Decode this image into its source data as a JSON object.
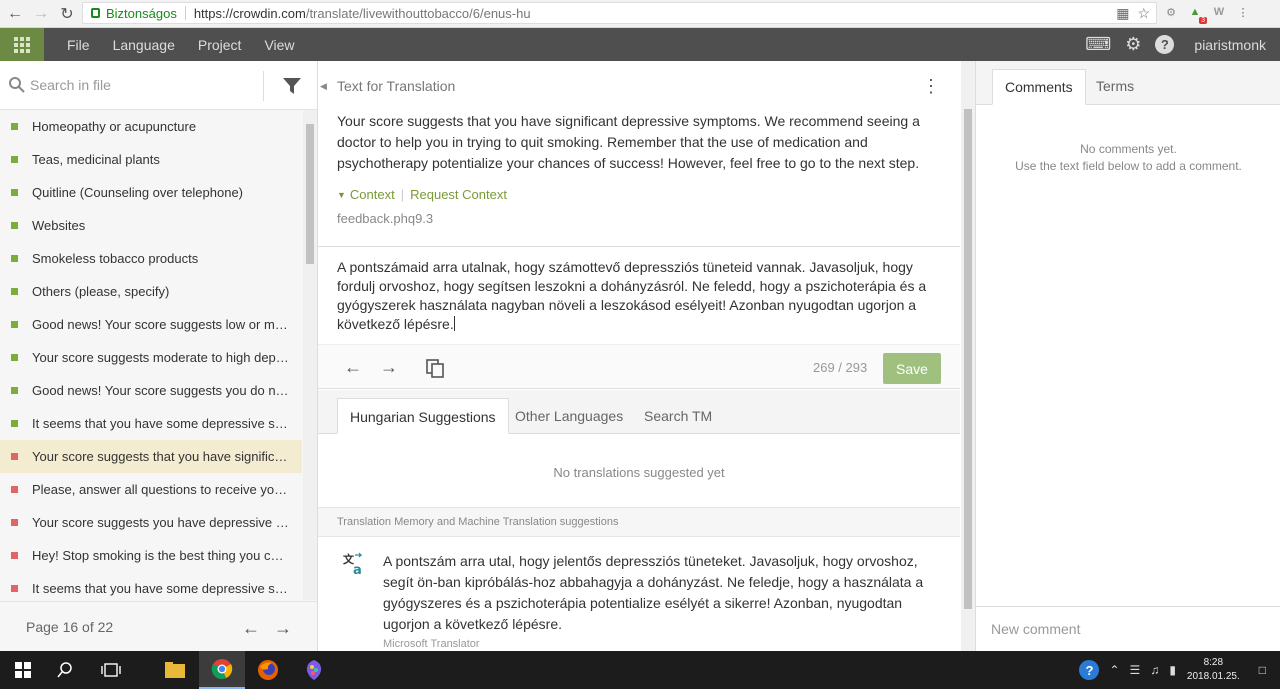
{
  "browser": {
    "secure_label": "Biztonságos",
    "url_host": "https://crowdin.com",
    "url_path": "/translate/livewithouttobacco/6/enus-hu",
    "extension_badge": "3"
  },
  "appbar": {
    "menu": [
      "File",
      "Language",
      "Project",
      "View"
    ],
    "username": "piaristmonk"
  },
  "sidebar": {
    "search_placeholder": "Search in file",
    "items": [
      {
        "label": "Homeopathy or acupuncture",
        "status_color": "#7cad3a",
        "active": false
      },
      {
        "label": "Teas, medicinal plants",
        "status_color": "#7cad3a",
        "active": false
      },
      {
        "label": "Quitline (Counseling over telephone)",
        "status_color": "#7cad3a",
        "active": false
      },
      {
        "label": "Websites",
        "status_color": "#7cad3a",
        "active": false
      },
      {
        "label": "Smokeless tobacco products",
        "status_color": "#7cad3a",
        "active": false
      },
      {
        "label": "Others (please, specify)",
        "status_color": "#7cad3a",
        "active": false
      },
      {
        "label": "Good news! Your score suggests low or mo...",
        "status_color": "#7cad3a",
        "active": false
      },
      {
        "label": "Your score suggests moderate to high depe...",
        "status_color": "#7cad3a",
        "active": false
      },
      {
        "label": "Good news! Your score suggests you do no...",
        "status_color": "#7cad3a",
        "active": false
      },
      {
        "label": "It seems that you have some depressive sy...",
        "status_color": "#7cad3a",
        "active": false
      },
      {
        "label": "Your score suggests that you have significa...",
        "status_color": "#e06666",
        "active": true
      },
      {
        "label": "Please, answer all questions to receive your...",
        "status_color": "#e06666",
        "active": false
      },
      {
        "label": "Your score suggests you have depressive id...",
        "status_color": "#e06666",
        "active": false
      },
      {
        "label": "Hey! Stop smoking is the best thing you can...",
        "status_color": "#e06666",
        "active": false
      },
      {
        "label": "It seems that you have some depressive sy...",
        "status_color": "#e06666",
        "active": false
      }
    ],
    "page_label": "Page 16 of 22"
  },
  "editor": {
    "source_header": "Text for Translation",
    "source_text": "Your score suggests that you have significant depressive symptoms. We recommend seeing a doctor to help you in trying to quit smoking. Remember that the use of medication and psychotherapy potentialize your chances of success! However, feel free to go to the next step.",
    "context_label": "Context",
    "request_context_label": "Request Context",
    "string_key": "feedback.phq9.3",
    "translation_text": "A pontszámaid arra utalnak, hogy számottevő depressziós tüneteid vannak. Javasoljuk, hogy fordulj orvoshoz, hogy segítsen leszokni a dohányzásról. Ne feledd, hogy a  pszichoterápia és a gyógyszerek használata nagyban növeli a leszokásod esélyeit! Azonban nyugodtan ugorjon a következő lépésre.",
    "char_count": "269 / 293",
    "save_label": "Save"
  },
  "suggestions": {
    "tabs": [
      "Hungarian Suggestions",
      "Other Languages",
      "Search TM"
    ],
    "empty_text": "No translations suggested yet",
    "tm_header": "Translation Memory and Machine Translation suggestions",
    "mt_text": "A pontszám arra utal, hogy jelentős depressziós tüneteket. Javasoljuk, hogy orvoshoz, segít ön-ban kipróbálás-hoz abbahagyja a dohányzást. Ne feledje, hogy a használata a gyógyszeres és a pszichoterápia potentialize esélyét a sikerre! Azonban, nyugodtan ugorjon a következő lépésre.",
    "mt_source": "Microsoft Translator"
  },
  "comments": {
    "tabs": [
      "Comments",
      "Terms"
    ],
    "empty_line1": "No comments yet.",
    "empty_line2": "Use the text field below to add a comment.",
    "input_placeholder": "New comment"
  },
  "taskbar": {
    "time": "8:28",
    "date": "2018.01.25."
  }
}
